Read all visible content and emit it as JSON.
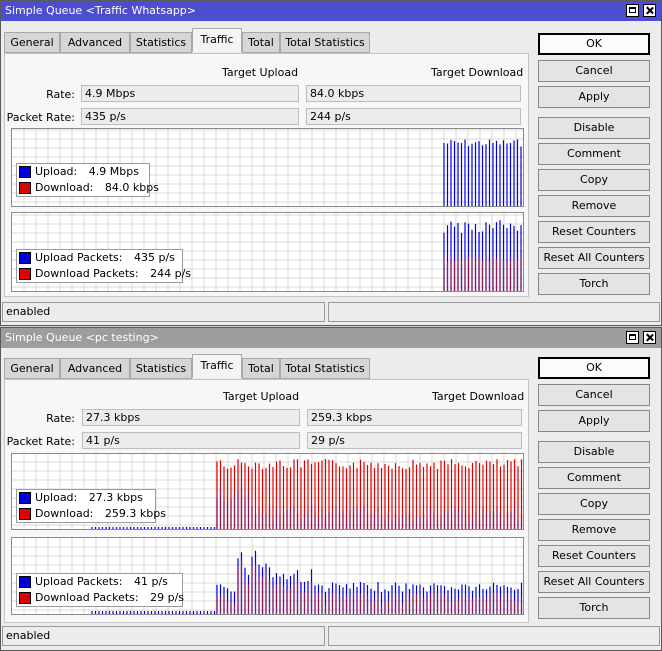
{
  "tabs": [
    "General",
    "Advanced",
    "Statistics",
    "Traffic",
    "Total",
    "Total Statistics"
  ],
  "headers": {
    "upload": "Target Upload",
    "download": "Target Download"
  },
  "labels": {
    "rate": "Rate:",
    "packet_rate": "Packet Rate:"
  },
  "buttons": [
    "OK",
    "Cancel",
    "Apply",
    "Disable",
    "Comment",
    "Copy",
    "Remove",
    "Reset Counters",
    "Reset All Counters",
    "Torch"
  ],
  "legend_labels": {
    "upload": "Upload:",
    "download": "Download:",
    "upload_packets": "Upload Packets:",
    "download_packets": "Download Packets:"
  },
  "colors": {
    "upload": "#0000e0",
    "download": "#e00000",
    "packets_overlap": "#8b1a5a"
  },
  "windows": [
    {
      "title": "Simple Queue <Traffic Whatsapp>",
      "active_tab": "Traffic",
      "rate_upload": "4.9 Mbps",
      "rate_download": "84.0 kbps",
      "packet_upload": "435 p/s",
      "packet_download": "244 p/s",
      "legend": {
        "upload": "4.9 Mbps",
        "download": "84.0 kbps",
        "upload_packets": "435 p/s",
        "download_packets": "244 p/s"
      },
      "status": "enabled"
    },
    {
      "title": "Simple Queue <pc testing>",
      "active_tab": "Traffic",
      "rate_upload": "27.3 kbps",
      "rate_download": "259.3 kbps",
      "packet_upload": "41 p/s",
      "packet_download": "29 p/s",
      "legend": {
        "upload": "27.3 kbps",
        "download": "259.3 kbps",
        "upload_packets": "41 p/s",
        "download_packets": "29 p/s"
      },
      "status": "enabled"
    }
  ]
}
